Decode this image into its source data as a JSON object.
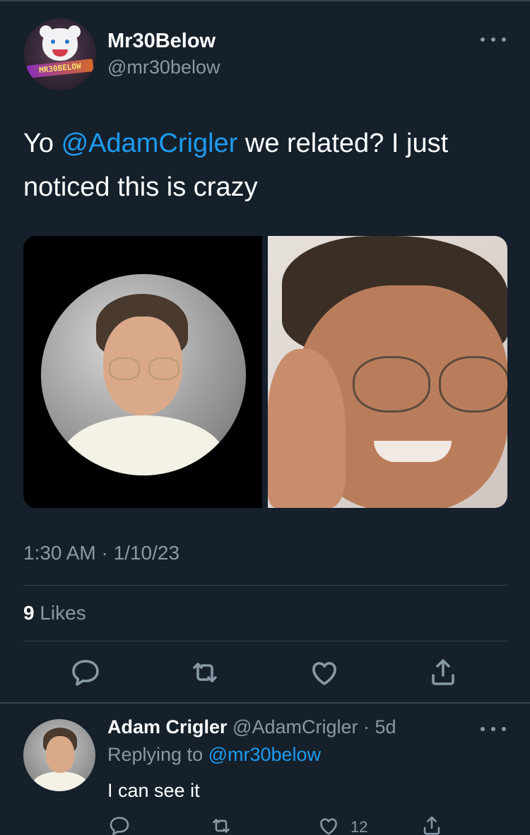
{
  "tweet": {
    "author": {
      "display_name": "Mr30Below",
      "handle": "@mr30below",
      "avatar_text": "MR30BELOW",
      "avatar_icon": "polar-bear-logo"
    },
    "text_before": "Yo ",
    "mention": "@AdamCrigler",
    "text_after": " we related? I just noticed this is crazy",
    "timestamp": "1:30 AM · 1/10/23",
    "likes_count": "9",
    "likes_label": " Likes",
    "action_icons": [
      "reply-icon",
      "retweet-icon",
      "like-icon",
      "share-icon"
    ]
  },
  "reply": {
    "display_name": "Adam Crigler",
    "handle_time": " @AdamCrigler · 5d",
    "replying_prefix": "Replying to ",
    "replying_to": "@mr30below",
    "text": "I can see it",
    "like_count": "12"
  },
  "colors": {
    "background": "#15202b",
    "accent": "#1d9bf0",
    "muted": "#8899a6",
    "divider": "#38444d"
  }
}
